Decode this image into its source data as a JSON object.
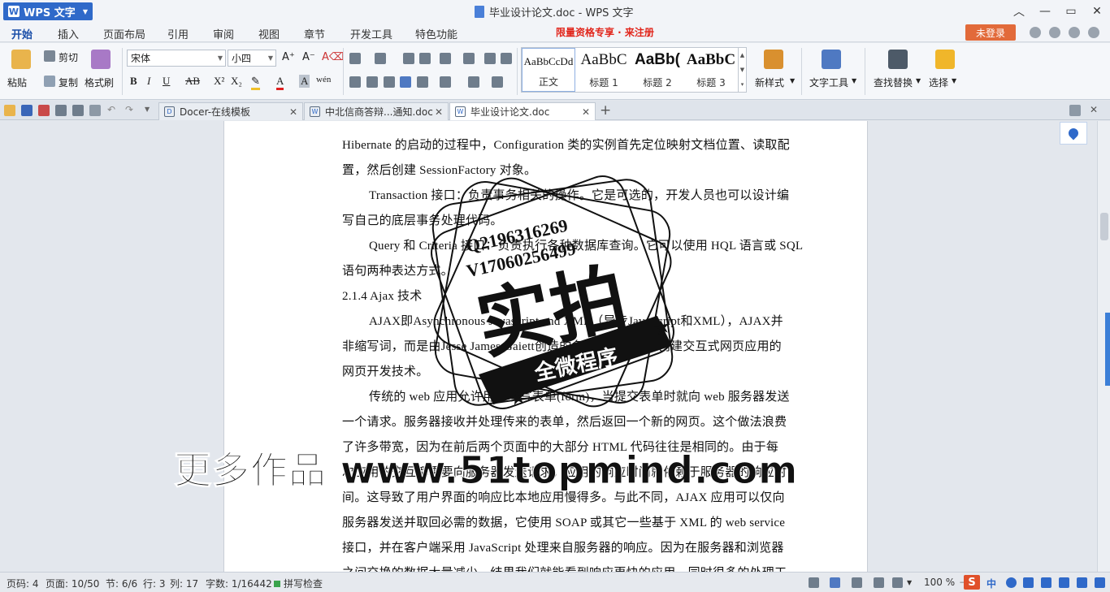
{
  "app": {
    "name": "WPS 文字"
  },
  "window": {
    "title": "毕业设计论文.doc - WPS 文字"
  },
  "menu": {
    "tabs": [
      "开始",
      "插入",
      "页面布局",
      "引用",
      "审阅",
      "视图",
      "章节",
      "开发工具",
      "特色功能"
    ],
    "promo_text": "限量资格专享 · 来注册",
    "login_label": "未登录"
  },
  "ribbon": {
    "paste": "粘贴",
    "cut": "剪切",
    "copy": "复制",
    "format_painter": "格式刷",
    "font_name": "宋体",
    "font_size": "小四",
    "styles": [
      {
        "preview": "AaBbCcDd",
        "label": "正文"
      },
      {
        "preview": "AaBbC",
        "label": "标题 1"
      },
      {
        "preview": "AaBb(",
        "label": "标题 2"
      },
      {
        "preview": "AaBbC",
        "label": "标题 3"
      }
    ],
    "new_style": "新样式",
    "text_tools": "文字工具",
    "find_replace": "查找替换",
    "select": "选择"
  },
  "doc_tabs": [
    {
      "label": "Docer-在线模板",
      "active": false
    },
    {
      "label": "中北信商答辩...通知.doc",
      "active": false
    },
    {
      "label": "毕业设计论文.doc",
      "active": true
    }
  ],
  "document": {
    "lines": [
      {
        "text": "Hibernate 的启动的过程中，Configuration 类的实例首先定位映射文档位置、读取配",
        "indent": false
      },
      {
        "text": "置，然后创建 SessionFactory 对象。",
        "indent": false
      },
      {
        "text": "Transaction 接口：负责事务相关的操作。它是可选的，开发人员也可以设计编",
        "indent": true
      },
      {
        "text": "写自己的底层事务处理代码。",
        "indent": false
      },
      {
        "text": "Query 和 Criteria 接口：负责执行各种数据库查询。它可以使用 HQL 语言或 SQL",
        "indent": true
      },
      {
        "text": "语句两种表达方式。",
        "indent": false
      },
      {
        "text": "2.1.4 Ajax 技术",
        "indent": false
      },
      {
        "text": "AJAX即Asynchronous Javascript and XML（异步JavaScript和XML），AJAX并",
        "indent": true
      },
      {
        "text": "非缩写词，而是由Jesse James Gaiett创造的名词，是指一种创建交互式网页应用的",
        "indent": false
      },
      {
        "text": "网页开发技术。",
        "indent": false
      },
      {
        "text": "传统的 web 应用允许用户填写表单(form)，当提交表单时就向 web 服务器发送",
        "indent": true
      },
      {
        "text": "一个请求。服务器接收并处理传来的表单，然后返回一个新的网页。这个做法浪费",
        "indent": false
      },
      {
        "text": "了许多带宽，因为在前后两个页面中的大部分 HTML 代码往往是相同的。由于每",
        "indent": false
      },
      {
        "text": "次应用的交互都需要向服务器发送请求，应用的响应时间就依赖于服务器的响应时",
        "indent": false
      },
      {
        "text": "间。这导致了用户界面的响应比本地应用慢得多。与此不同，AJAX 应用可以仅向",
        "indent": false
      },
      {
        "text": "服务器发送并取回必需的数据，它使用 SOAP 或其它一些基于 XML 的 web service",
        "indent": false
      },
      {
        "text": "接口，并在客户端采用 JavaScript 处理来自服务器的响应。因为在服务器和浏览器",
        "indent": false
      },
      {
        "text": "之间交换的数据大量减少，结果我们就能看到响应更快的应用。同时很多的处理工",
        "indent": false
      }
    ]
  },
  "stamp": {
    "qq": "Q2196316269",
    "wx": "V17060256499",
    "big": "实拍",
    "ribbon": "全微程序"
  },
  "watermark": "更多作品 www.51topmind.com",
  "status": {
    "page_no": "页码: 4",
    "pages": "页面: 10/50",
    "section": "节: 6/6",
    "row": "行: 3",
    "col": "列: 17",
    "words": "字数: 1/16442",
    "spell": "拼写检查",
    "zoom": "100 %",
    "ime": "中"
  }
}
